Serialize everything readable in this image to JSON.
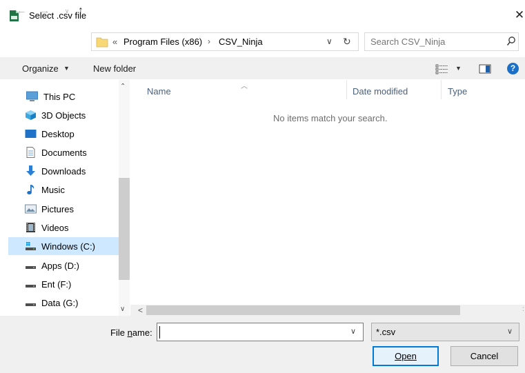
{
  "window": {
    "title": "Select .csv file",
    "close_glyph": "✕"
  },
  "nav_buttons": {
    "back": "←",
    "forward": "→",
    "recent": "∨",
    "up": "↑"
  },
  "address": {
    "overflow": "«",
    "crumbs": [
      "Program Files (x86)",
      "CSV_Ninja"
    ],
    "separator": "›",
    "dropdown": "∨",
    "refresh": "↻"
  },
  "search": {
    "placeholder": "Search CSV_Ninja",
    "icon": "search-icon"
  },
  "toolbar": {
    "organize_label": "Organize",
    "caret": "▼",
    "new_folder_label": "New folder",
    "help_label": "?"
  },
  "navigation": {
    "items": [
      {
        "label": "This PC",
        "icon": "computer-icon"
      },
      {
        "label": "3D Objects",
        "icon": "cube-icon"
      },
      {
        "label": "Desktop",
        "icon": "desktop-icon"
      },
      {
        "label": "Documents",
        "icon": "document-icon"
      },
      {
        "label": "Downloads",
        "icon": "download-arrow-icon"
      },
      {
        "label": "Music",
        "icon": "music-note-icon"
      },
      {
        "label": "Pictures",
        "icon": "picture-icon"
      },
      {
        "label": "Videos",
        "icon": "film-icon"
      },
      {
        "label": "Windows (C:)",
        "icon": "windows-drive-icon",
        "selected": true
      },
      {
        "label": "Apps (D:)",
        "icon": "drive-icon"
      },
      {
        "label": "Ent (F:)",
        "icon": "drive-icon"
      },
      {
        "label": "Data (G:)",
        "icon": "drive-icon"
      }
    ],
    "scroll_up": "⌃",
    "scroll_down": "∨"
  },
  "file_list": {
    "columns": [
      "Name",
      "Date modified",
      "Type"
    ],
    "sort_arrow": "︿",
    "empty_message": "No items match your search.",
    "scroll_left": "<",
    "scroll_right": ":"
  },
  "footer": {
    "file_name_label_pre": "File ",
    "file_name_label_accel": "n",
    "file_name_label_post": "ame:",
    "file_name_value": "",
    "file_name_caret": "∨",
    "file_type_value": "*.csv",
    "file_type_caret": "∨",
    "open_label": "Open",
    "cancel_label": "Cancel"
  },
  "colors": {
    "accent": "#0078d7",
    "selection": "#cde8ff",
    "help_blue": "#1a6fc9",
    "folder_yellow": "#f8d775"
  }
}
